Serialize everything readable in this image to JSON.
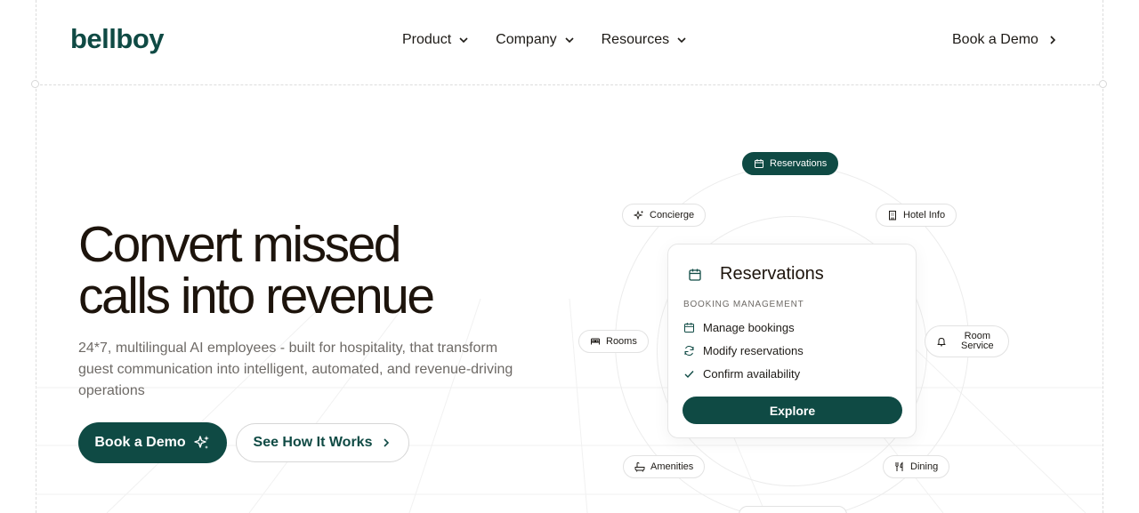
{
  "brand": {
    "name": "bellboy",
    "color": "#0f4a44"
  },
  "nav": {
    "items": [
      {
        "label": "Product",
        "icon": "chevron-down-icon"
      },
      {
        "label": "Company",
        "icon": "chevron-down-icon"
      },
      {
        "label": "Resources",
        "icon": "chevron-down-icon"
      }
    ],
    "cta_label": "Book a Demo"
  },
  "hero": {
    "headline_line1": "Convert missed",
    "headline_line2": "calls into revenue",
    "subtext": "24*7, multilingual AI employees - built for hospitality, that transform guest communication into intelligent, automated, and revenue-driving operations",
    "primary_button": "Book a Demo",
    "secondary_button": "See How It Works"
  },
  "chips": {
    "reservations": {
      "label": "Reservations",
      "icon": "calendar-icon"
    },
    "concierge": {
      "label": "Concierge",
      "icon": "sparkle-icon"
    },
    "hotel_info": {
      "label": "Hotel Info",
      "icon": "building-icon"
    },
    "rooms": {
      "label": "Rooms",
      "icon": "bed-icon"
    },
    "room_service_line1": "Room",
    "room_service_line2": "Service",
    "room_service_icon": "bell-icon",
    "amenities": {
      "label": "Amenities",
      "icon": "bathtub-icon"
    },
    "dining": {
      "label": "Dining",
      "icon": "utensils-icon"
    }
  },
  "card": {
    "title": "Reservations",
    "subtitle": "BOOKING MANAGEMENT",
    "features": [
      {
        "label": "Manage bookings",
        "icon": "calendar-icon"
      },
      {
        "label": "Modify reservations",
        "icon": "refresh-icon"
      },
      {
        "label": "Confirm availability",
        "icon": "check-icon"
      }
    ],
    "button": "Explore"
  }
}
